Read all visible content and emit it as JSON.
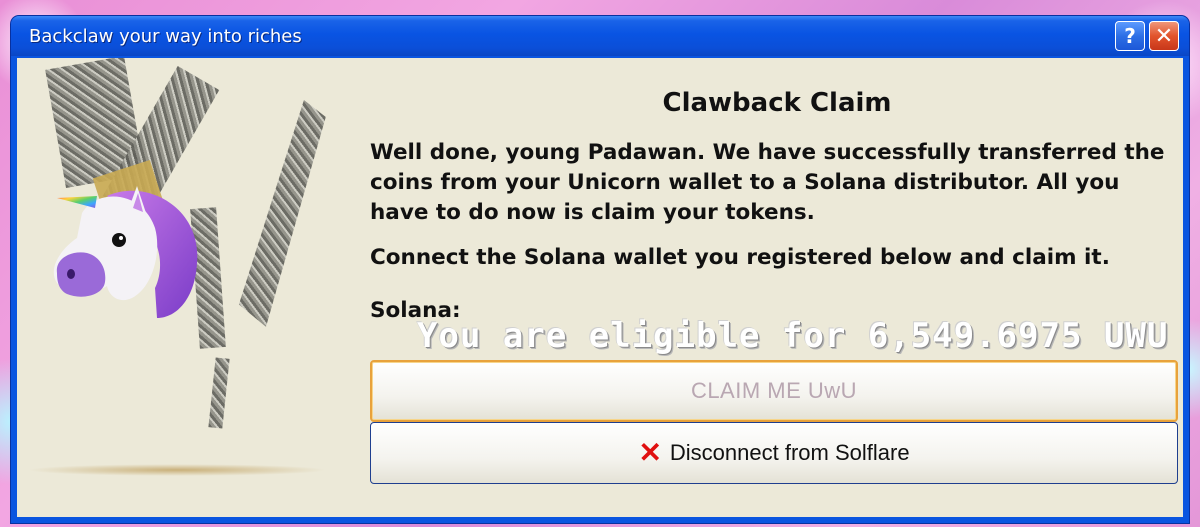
{
  "window": {
    "title": "Backclaw your way into riches",
    "help_label": "?",
    "close_label": "✕"
  },
  "dialog": {
    "heading": "Clawback Claim",
    "paragraph1": "Well done, young Padawan. We have successfully transferred the coins from your Unicorn wallet to a Solana distributor. All you have to do now is claim your tokens.",
    "paragraph2": "Connect the Solana wallet you registered below and claim it.",
    "solana_label": "Solana:",
    "eligible_text": "You are eligible for 6,549.6975 UWU",
    "claim_button": "CLAIM ME UwU",
    "disconnect_button": "Disconnect from Solflare"
  },
  "icons": {
    "unicorn": "unicorn-icon",
    "disconnect": "x-icon",
    "help": "question-icon",
    "close": "close-icon"
  },
  "colors": {
    "titlebar": "#0a55e0",
    "client_bg": "#ece9d8",
    "claim_border": "#e8a23c",
    "claim_text": "#b9a7b2",
    "close_red": "#e2542c",
    "disconnect_x": "#e01010"
  }
}
